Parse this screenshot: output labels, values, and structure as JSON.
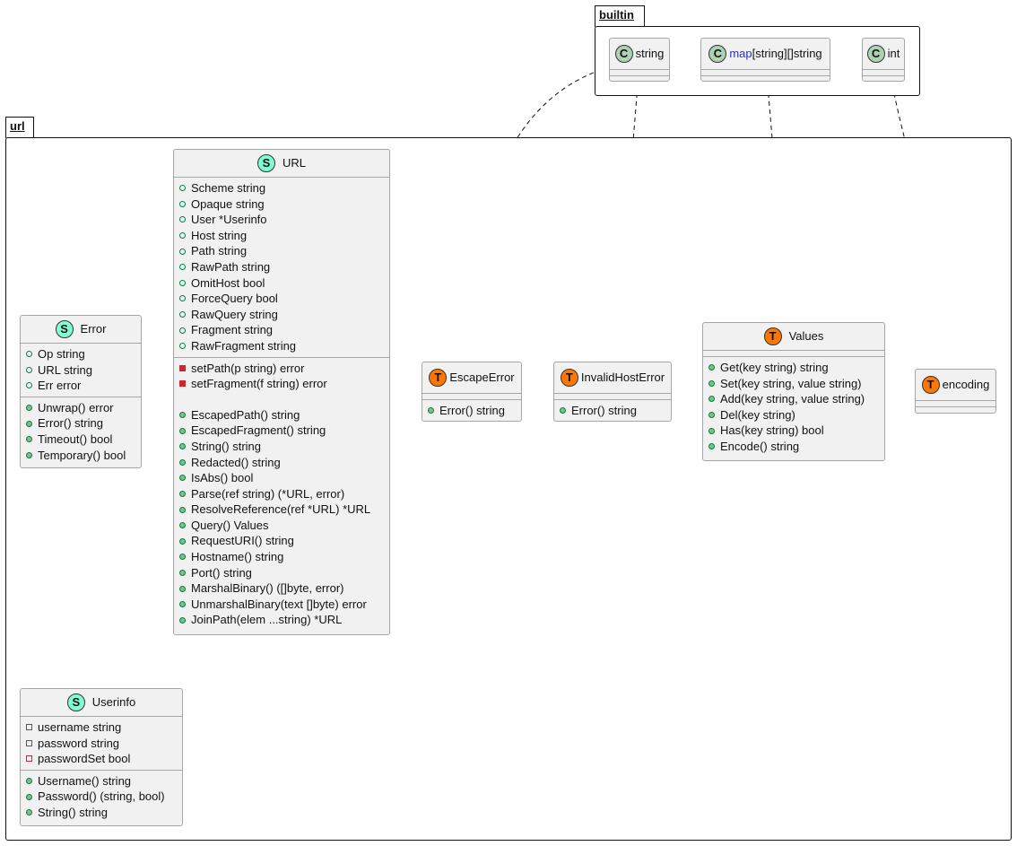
{
  "packages": {
    "builtin": "builtin",
    "url": "url"
  },
  "builtin": {
    "string": "string",
    "map_kw": "map",
    "map_rest": "[string][]string",
    "int": "int"
  },
  "classes": {
    "error": {
      "name": "Error",
      "stereotype": "S",
      "fields": [
        "Op string",
        "URL string",
        "Err error"
      ],
      "methods": [
        "Unwrap() error",
        "Error() string",
        "Timeout() bool",
        "Temporary() bool"
      ]
    },
    "url": {
      "name": "URL",
      "stereotype": "S",
      "fields": [
        "Scheme string",
        "Opaque string",
        "User *Userinfo",
        "Host string",
        "Path string",
        "RawPath string",
        "OmitHost bool",
        "ForceQuery bool",
        "RawQuery string",
        "Fragment string",
        "RawFragment string"
      ],
      "private_methods": [
        "setPath(p string) error",
        "setFragment(f string) error"
      ],
      "methods": [
        "EscapedPath() string",
        "EscapedFragment() string",
        "String() string",
        "Redacted() string",
        "IsAbs() bool",
        "Parse(ref string) (*URL, error)",
        "ResolveReference(ref *URL) *URL",
        "Query() Values",
        "RequestURI() string",
        "Hostname() string",
        "Port() string",
        "MarshalBinary() ([]byte, error)",
        "UnmarshalBinary(text []byte) error",
        "JoinPath(elem ...string) *URL"
      ]
    },
    "escape_error": {
      "name": "EscapeError",
      "stereotype": "T",
      "methods": [
        "Error() string"
      ]
    },
    "invalid_host_error": {
      "name": "InvalidHostError",
      "stereotype": "T",
      "methods": [
        "Error() string"
      ]
    },
    "values": {
      "name": "Values",
      "stereotype": "T",
      "methods": [
        "Get(key string) string",
        "Set(key string, value string)",
        "Add(key string, value string)",
        "Del(key string)",
        "Has(key string) bool",
        "Encode() string"
      ]
    },
    "encoding": {
      "name": "encoding",
      "stereotype": "T"
    },
    "userinfo": {
      "name": "Userinfo",
      "stereotype": "S",
      "fields": [
        "username string",
        "password string",
        "passwordSet bool"
      ],
      "methods": [
        "Username() string",
        "Password() (string, bool)",
        "String() string"
      ]
    }
  },
  "builtin_stereotype": "C"
}
